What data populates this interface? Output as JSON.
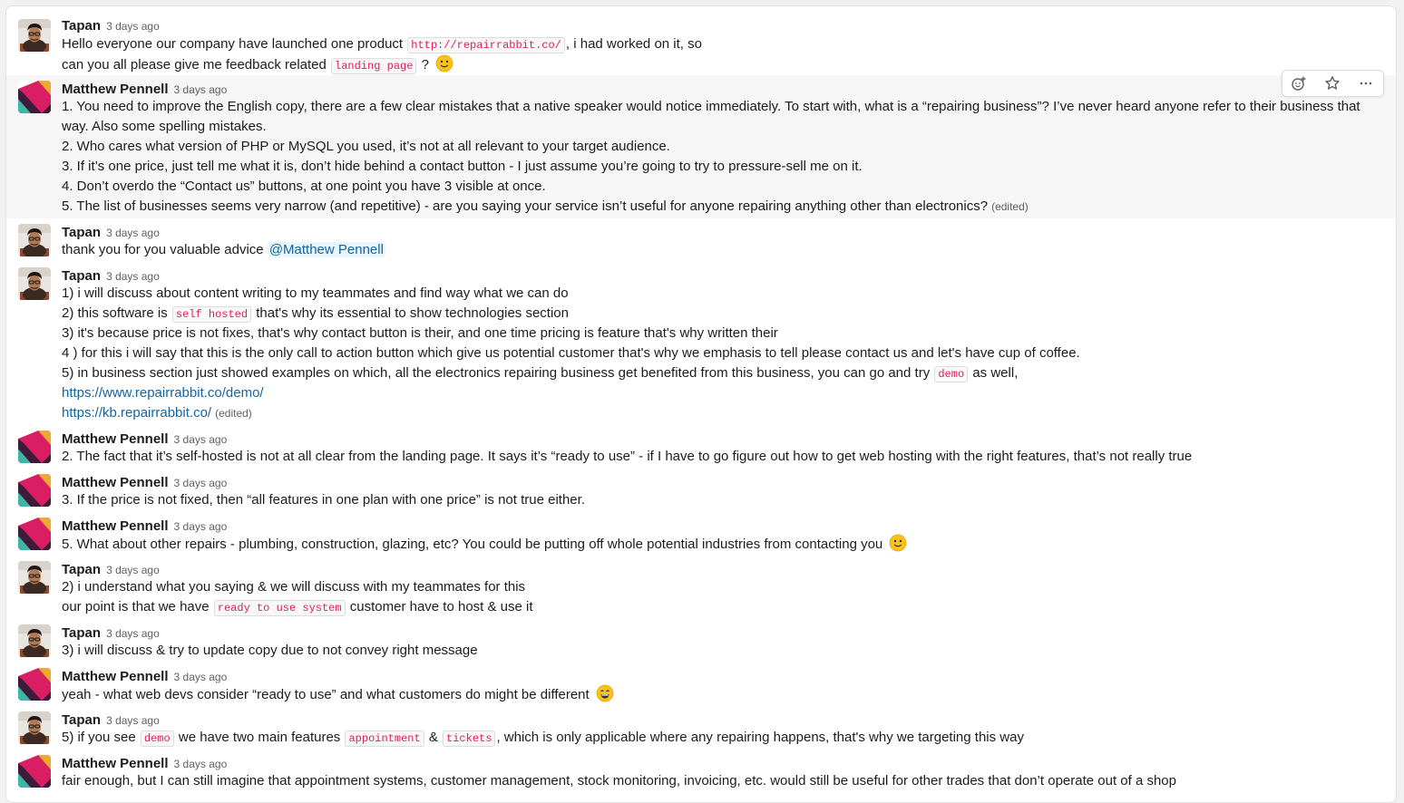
{
  "messages": [
    {
      "author": "Tapan",
      "time": "3 days ago",
      "lines": [
        {
          "t1": "Hello everyone our company have launched one product ",
          "code": "http://repairrabbit.co/",
          "t2": ", i had worked on it, so"
        },
        {
          "t1": "can you all please give me feedback related ",
          "code": "landing page",
          "t2": " ?"
        }
      ]
    },
    {
      "author": "Matthew Pennell",
      "time": "3 days ago",
      "lines": [
        "1. You need to improve the English copy, there are a few clear mistakes that a native speaker would notice immediately. To start with, what is a “repairing business”? I’ve never heard anyone refer to their business that",
        "way. Also some spelling mistakes.",
        "2. Who cares what version of PHP or MySQL you used, it’s not at all relevant to your target audience.",
        "3. If it’s one price, just tell me what it is, don’t hide behind a contact button - I just assume you’re going to try to pressure-sell me on it.",
        "4. Don’t overdo the “Contact us” buttons, at one point you have 3 visible at once.",
        "5. The list of businesses seems very narrow (and repetitive) - are you saying your service isn’t useful for anyone repairing anything other than electronics?"
      ],
      "edited": "(edited)"
    },
    {
      "author": "Tapan",
      "time": "3 days ago",
      "text": "thank you for you valuable advice ",
      "mention": "@Matthew Pennell"
    },
    {
      "author": "Tapan",
      "time": "3 days ago",
      "lines": [
        "1) i will discuss about content writing to my teammates and find way what we can do",
        {
          "t1": "2) this software is ",
          "code": "self hosted",
          "t2": " that's why its essential to show technologies section"
        },
        "3) it's because price is not fixes, that's why contact button is their, and one time pricing is feature that's why written their",
        "4 ) for this i will say that this is the only call to action button which give us potential customer that's why we emphasis to tell please contact us and let's have cup of coffee.",
        {
          "t1": "5) in business section just showed examples on which, all the electronics repairing business get benefited from this business, you can go and try ",
          "code": "demo",
          "t2": " as well,"
        }
      ],
      "links": [
        "https://www.repairrabbit.co/demo/",
        "https://kb.repairrabbit.co/"
      ],
      "edited": "(edited)"
    },
    {
      "author": "Matthew Pennell",
      "time": "3 days ago",
      "text": "2. The fact that it’s self-hosted is not at all clear from the landing page. It says it’s “ready to use” - if I have to go figure out how to get web hosting with the right features, that’s not really true"
    },
    {
      "author": "Matthew Pennell",
      "time": "3 days ago",
      "text": "3. If the price is not fixed, then “all features in one plan with one price” is not true either."
    },
    {
      "author": "Matthew Pennell",
      "time": "3 days ago",
      "text": "5. What about other repairs - plumbing, construction, glazing, etc? You could be putting off whole potential industries from contacting you"
    },
    {
      "author": "Tapan",
      "time": "3 days ago",
      "lines": [
        "2) i understand what you saying & we will discuss with my teammates for this",
        {
          "t1": "our point is that we have ",
          "code": "ready to use system",
          "t2": " customer have to host & use it"
        }
      ]
    },
    {
      "author": "Tapan",
      "time": "3 days ago",
      "text": "3) i will discuss & try to update copy due to not convey right message"
    },
    {
      "author": "Matthew Pennell",
      "time": "3 days ago",
      "text": "yeah - what web devs consider “ready to use” and what customers do might be different"
    },
    {
      "author": "Tapan",
      "time": "3 days ago",
      "t1": "5) if you see ",
      "code1": "demo",
      "t2": " we have two main features ",
      "code2": "appointment",
      "t3": " & ",
      "code3": "tickets",
      "t4": ", which is only applicable where any repairing happens, that's why we targeting this way"
    },
    {
      "author": "Matthew Pennell",
      "time": "3 days ago",
      "text": "fair enough, but I can still imagine that appointment systems, customer management, stock monitoring, invoicing, etc. would still be useful for other trades that don’t operate out of a shop"
    }
  ],
  "actions": {
    "add_reaction_icon": "add-reaction-icon",
    "star_icon": "star-icon",
    "more_icon": "more-actions-icon"
  },
  "colors": {
    "code_text": "#e01e5a",
    "link": "#1264a3",
    "hover_bg": "#f6f6f6"
  }
}
